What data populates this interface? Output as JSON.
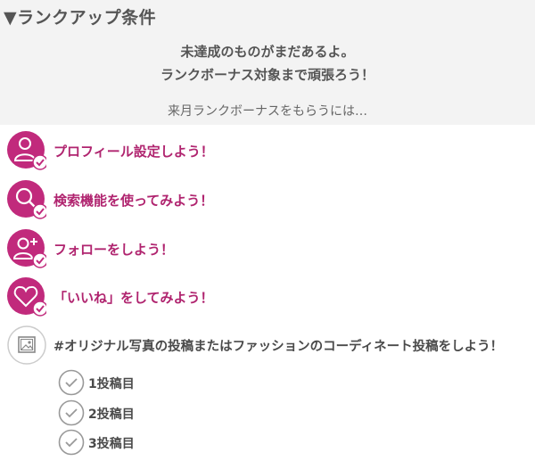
{
  "header": {
    "title": "▼ランクアップ条件"
  },
  "status": {
    "line1": "未達成のものがまだあるよ。",
    "line2": "ランクボーナス対象まで頑張ろう！",
    "hint": "来月ランクボーナスをもらうには…"
  },
  "tasks": [
    {
      "label": "プロフィール設定しよう！",
      "icon": "user-icon",
      "color": "#c12a7c"
    },
    {
      "label": "検索機能を使ってみよう！",
      "icon": "search-icon",
      "color": "#c12a7c"
    },
    {
      "label": "フォローをしよう！",
      "icon": "add-user-icon",
      "color": "#c12a7c"
    },
    {
      "label": "「いいね」をしてみよう！",
      "icon": "heart-icon",
      "color": "#c12a7c"
    },
    {
      "label": "#オリジナル写真の投稿またはファッションのコーディネート投稿をしよう！",
      "icon": "image-icon"
    }
  ],
  "post_steps": [
    {
      "label": "1投稿目"
    },
    {
      "label": "2投稿目"
    },
    {
      "label": "3投稿目"
    }
  ],
  "colors": {
    "accent": "#c12a7c",
    "incomplete": "#999999",
    "background_top": "#f3f3f3"
  }
}
